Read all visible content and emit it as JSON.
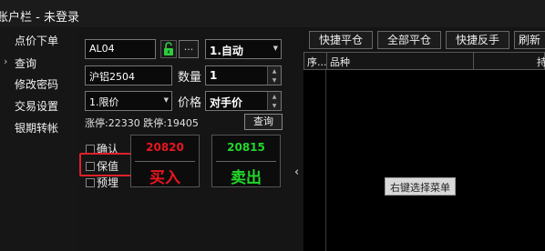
{
  "window": {
    "title": "账户栏 - 未登录"
  },
  "sidebar": {
    "items": [
      {
        "label": "点价下单"
      },
      {
        "label": "查询",
        "has_arrow": true
      },
      {
        "label": "修改密码"
      },
      {
        "label": "交易设置"
      },
      {
        "label": "银期转帐"
      }
    ],
    "arrow_glyph": "›"
  },
  "order": {
    "account_value": "AL04",
    "dots_label": "...",
    "mode_value": "1.自动",
    "contract_value": "沪铝2504",
    "qty_label": "数量",
    "qty_value": "1",
    "price_type_value": "1.限价",
    "price_label": "价格",
    "price_value": "对手价",
    "limit_text": "涨停:22330 跌停:19405",
    "query_button": "查询",
    "checkboxes": [
      {
        "label": "确认",
        "checked": false
      },
      {
        "label": "保值",
        "checked": false
      },
      {
        "label": "预埋",
        "checked": false
      }
    ],
    "buy": {
      "price": "20820",
      "label": "买入",
      "color": "#e8161e"
    },
    "sell": {
      "price": "20815",
      "label": "卖出",
      "color": "#22d62a"
    }
  },
  "collapse_glyph": "‹",
  "toolbar": {
    "buttons": [
      "快捷平仓",
      "全部平仓",
      "快捷反手",
      "刷新"
    ]
  },
  "table": {
    "headers": [
      "序...",
      "品种",
      "持"
    ]
  },
  "tooltip": {
    "text": "右键选择菜单"
  }
}
